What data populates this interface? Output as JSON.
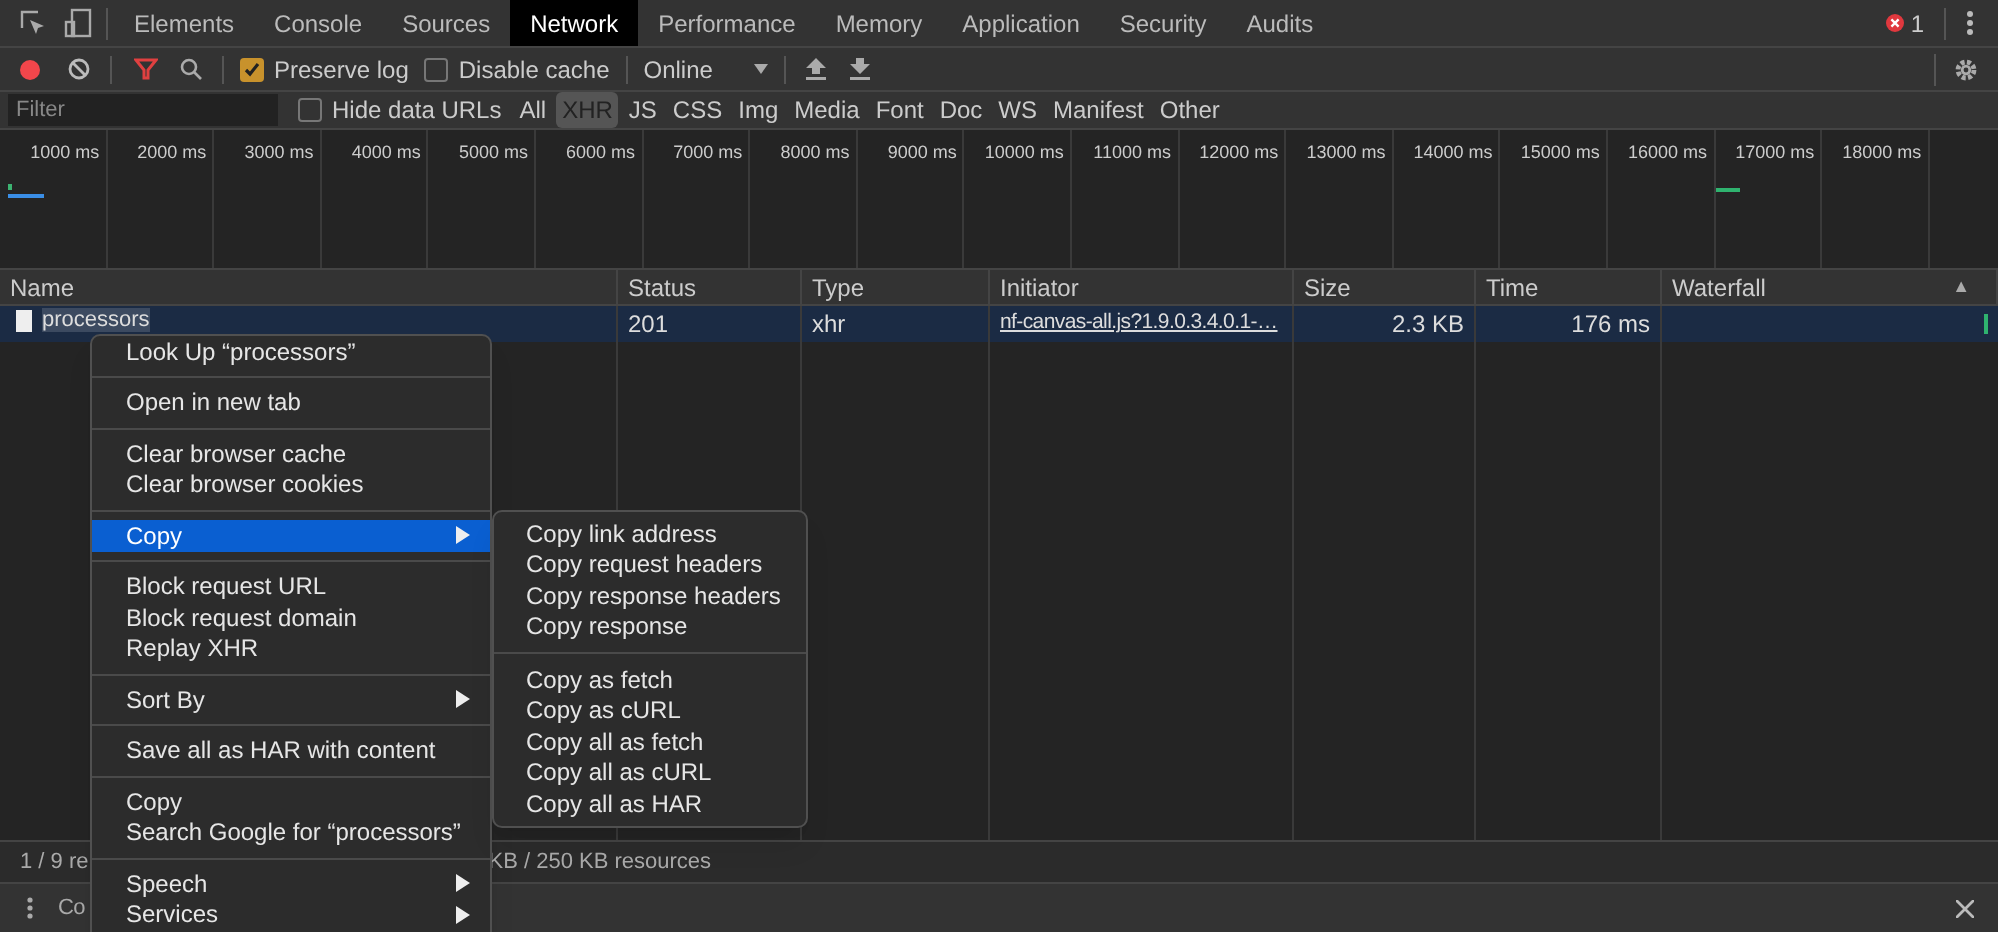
{
  "tabs": [
    {
      "label": "Elements",
      "selected": false
    },
    {
      "label": "Console",
      "selected": false
    },
    {
      "label": "Sources",
      "selected": false
    },
    {
      "label": "Network",
      "selected": true
    },
    {
      "label": "Performance",
      "selected": false
    },
    {
      "label": "Memory",
      "selected": false
    },
    {
      "label": "Application",
      "selected": false
    },
    {
      "label": "Security",
      "selected": false
    },
    {
      "label": "Audits",
      "selected": false
    }
  ],
  "error_count": "1",
  "toolbar": {
    "recording": true,
    "preserve_log": {
      "label": "Preserve log",
      "checked": true
    },
    "disable_cache": {
      "label": "Disable cache",
      "checked": false
    },
    "throttling": "Online"
  },
  "filter": {
    "placeholder": "Filter",
    "hide_data_urls": {
      "label": "Hide data URLs",
      "checked": false
    },
    "types": [
      {
        "label": "All",
        "selected": false
      },
      {
        "label": "XHR",
        "selected": true
      },
      {
        "label": "JS",
        "selected": false
      },
      {
        "label": "CSS",
        "selected": false
      },
      {
        "label": "Img",
        "selected": false
      },
      {
        "label": "Media",
        "selected": false
      },
      {
        "label": "Font",
        "selected": false
      },
      {
        "label": "Doc",
        "selected": false
      },
      {
        "label": "WS",
        "selected": false
      },
      {
        "label": "Manifest",
        "selected": false
      },
      {
        "label": "Other",
        "selected": false
      }
    ]
  },
  "overview": {
    "ticks": [
      "1000 ms",
      "2000 ms",
      "3000 ms",
      "4000 ms",
      "5000 ms",
      "6000 ms",
      "7000 ms",
      "8000 ms",
      "9000 ms",
      "10000 ms",
      "11000 ms",
      "12000 ms",
      "13000 ms",
      "14000 ms",
      "15000 ms",
      "16000 ms",
      "17000 ms",
      "18000 ms"
    ]
  },
  "table": {
    "columns": [
      "Name",
      "Status",
      "Type",
      "Initiator",
      "Size",
      "Time",
      "Waterfall"
    ],
    "sort_indicator": "▲",
    "rows": [
      {
        "name": "processors",
        "status": "201",
        "type": "xhr",
        "initiator": "nf-canvas-all.js?1.9.0.3.4.0.1-…",
        "size": "2.3 KB",
        "time": "176 ms",
        "selected": true
      }
    ]
  },
  "status_bar": [
    "1 / 9 re",
    "KB / 250 KB resources"
  ],
  "drawer": {
    "tab": "Co"
  },
  "context_menu": {
    "groups": [
      [
        {
          "label": "Look Up “processors”",
          "submenu": false,
          "selected": false
        }
      ],
      [
        {
          "label": "Open in new tab",
          "submenu": false,
          "selected": false
        }
      ],
      [
        {
          "label": "Clear browser cache",
          "submenu": false,
          "selected": false
        },
        {
          "label": "Clear browser cookies",
          "submenu": false,
          "selected": false
        }
      ],
      [
        {
          "label": "Copy",
          "submenu": true,
          "selected": true
        }
      ],
      [
        {
          "label": "Block request URL",
          "submenu": false,
          "selected": false
        },
        {
          "label": "Block request domain",
          "submenu": false,
          "selected": false
        },
        {
          "label": "Replay XHR",
          "submenu": false,
          "selected": false
        }
      ],
      [
        {
          "label": "Sort By",
          "submenu": true,
          "selected": false
        }
      ],
      [
        {
          "label": "Save all as HAR with content",
          "submenu": false,
          "selected": false
        }
      ],
      [
        {
          "label": "Copy",
          "submenu": false,
          "selected": false
        },
        {
          "label": "Search Google for “processors”",
          "submenu": false,
          "selected": false
        }
      ],
      [
        {
          "label": "Speech",
          "submenu": true,
          "selected": false
        },
        {
          "label": "Services",
          "submenu": true,
          "selected": false
        }
      ]
    ]
  },
  "submenu": {
    "groups": [
      [
        {
          "label": "Copy link address"
        },
        {
          "label": "Copy request headers"
        },
        {
          "label": "Copy response headers"
        },
        {
          "label": "Copy response"
        }
      ],
      [
        {
          "label": "Copy as fetch"
        },
        {
          "label": "Copy as cURL"
        },
        {
          "label": "Copy all as fetch"
        },
        {
          "label": "Copy all as cURL"
        },
        {
          "label": "Copy all as HAR"
        }
      ]
    ]
  }
}
